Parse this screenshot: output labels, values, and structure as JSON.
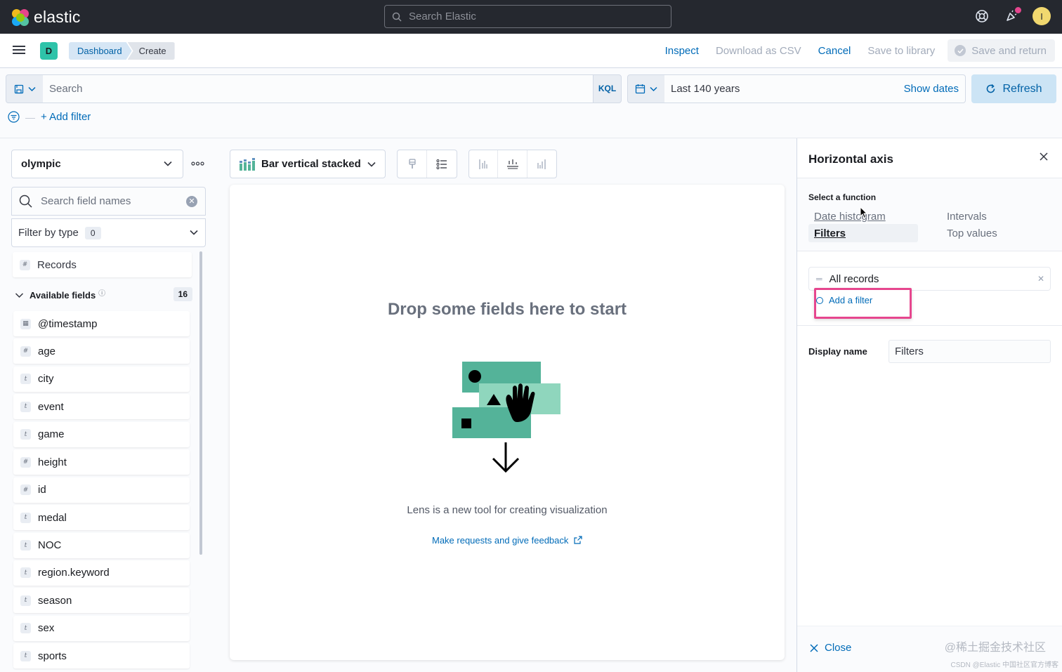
{
  "topbar": {
    "brand": "elastic",
    "search_placeholder": "Search Elastic",
    "user_initial": "I"
  },
  "header": {
    "space_initial": "D",
    "breadcrumbs": [
      "Dashboard",
      "Create"
    ],
    "actions": {
      "inspect": "Inspect",
      "download_csv": "Download as CSV",
      "cancel": "Cancel",
      "save_library": "Save to library",
      "save_return": "Save and return"
    }
  },
  "query": {
    "search_placeholder": "Search",
    "language": "KQL",
    "date_range": "Last 140 years",
    "show_dates": "Show dates",
    "refresh": "Refresh",
    "add_filter": "+ Add filter"
  },
  "datasource": {
    "index": "olympic",
    "field_search_placeholder": "Search field names",
    "filter_by_type": "Filter by type",
    "filter_count": "0",
    "records": "Records",
    "available_fields_label": "Available fields",
    "available_count": "16",
    "fields": [
      {
        "name": "@timestamp",
        "type": "date",
        "icon": "▦"
      },
      {
        "name": "age",
        "type": "number",
        "icon": "#"
      },
      {
        "name": "city",
        "type": "string",
        "icon": "t"
      },
      {
        "name": "event",
        "type": "string",
        "icon": "t"
      },
      {
        "name": "game",
        "type": "string",
        "icon": "t"
      },
      {
        "name": "height",
        "type": "number",
        "icon": "#"
      },
      {
        "name": "id",
        "type": "number",
        "icon": "#"
      },
      {
        "name": "medal",
        "type": "string",
        "icon": "t"
      },
      {
        "name": "NOC",
        "type": "string",
        "icon": "t"
      },
      {
        "name": "region.keyword",
        "type": "string",
        "icon": "t"
      },
      {
        "name": "season",
        "type": "string",
        "icon": "t"
      },
      {
        "name": "sex",
        "type": "string",
        "icon": "t"
      },
      {
        "name": "sports",
        "type": "string",
        "icon": "t"
      }
    ]
  },
  "workspace": {
    "chart_type": "Bar vertical stacked",
    "drop_title": "Drop some fields here to start",
    "description": "Lens is a new tool for creating visualization",
    "feedback_link": "Make requests and give feedback"
  },
  "flyout": {
    "title": "Horizontal axis",
    "select_function_label": "Select a function",
    "functions": [
      "Date histogram",
      "Filters",
      "Intervals",
      "Top values"
    ],
    "selected_function": "Filters",
    "filter_items": [
      "All records"
    ],
    "add_filter": "Add a filter",
    "display_name_label": "Display name",
    "display_name_value": "Filters",
    "close": "Close"
  },
  "watermark": {
    "line1": "@稀土掘金技术社区",
    "line2": "CSDN @Elastic 中国社区官方博客"
  },
  "colors": {
    "accent": "#006bb8",
    "highlight": "#e6468e",
    "topbar": "#25282f",
    "illustration_green": "#54b399"
  }
}
